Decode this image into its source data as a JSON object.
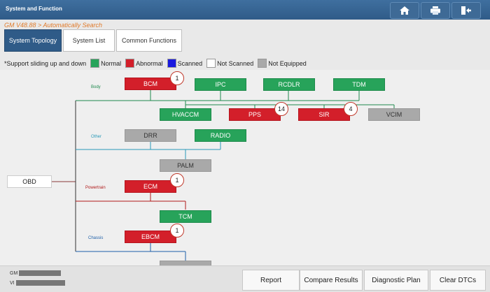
{
  "header": {
    "title": "System and Function",
    "buttons": [
      {
        "name": "home-icon"
      },
      {
        "name": "print-icon"
      },
      {
        "name": "exit-icon"
      }
    ]
  },
  "breadcrumb": "GM V48.88 > Automatically Search",
  "tabs": [
    {
      "label": "System Topology"
    },
    {
      "label": "System List"
    },
    {
      "label": "Common Functions"
    }
  ],
  "legend": {
    "note": "*Support sliding up and down",
    "items": [
      {
        "label": "Normal",
        "color": "#27a35a"
      },
      {
        "label": "Abnormal",
        "color": "#d31f2a"
      },
      {
        "label": "Scanned",
        "color": "#1a1adf"
      },
      {
        "label": "Not Scanned",
        "color": "#ffffff"
      },
      {
        "label": "Not Equipped",
        "color": "#a9a9a9"
      }
    ]
  },
  "topology": {
    "root": "OBD",
    "groups": [
      {
        "label": "Body",
        "color": "#1f8a4e"
      },
      {
        "label": "Other",
        "color": "#2a9ab8"
      },
      {
        "label": "Powertrain",
        "color": "#b01a1a"
      },
      {
        "label": "Chassis",
        "color": "#1e5fa8"
      }
    ],
    "modules": [
      {
        "label": "BCM",
        "status": "abnormal",
        "badge": "1"
      },
      {
        "label": "IPC",
        "status": "normal"
      },
      {
        "label": "RCDLR",
        "status": "normal"
      },
      {
        "label": "TDM",
        "status": "normal"
      },
      {
        "label": "HVACCM",
        "status": "normal"
      },
      {
        "label": "PPS",
        "status": "abnormal",
        "badge": "14"
      },
      {
        "label": "SIR",
        "status": "abnormal",
        "badge": "4"
      },
      {
        "label": "VCIM",
        "status": "not-equipped"
      },
      {
        "label": "DRR",
        "status": "not-equipped"
      },
      {
        "label": "RADIO",
        "status": "normal"
      },
      {
        "label": "PALM",
        "status": "not-equipped"
      },
      {
        "label": "ECM",
        "status": "abnormal",
        "badge": "1"
      },
      {
        "label": "TCM",
        "status": "normal"
      },
      {
        "label": "EBCM",
        "status": "abnormal",
        "badge": "1"
      }
    ]
  },
  "vehicle": {
    "line1_prefix": "GM",
    "line2_prefix": "VI"
  },
  "footer": {
    "buttons": [
      {
        "label": "Report"
      },
      {
        "label": "Compare Results"
      },
      {
        "label": "Diagnostic Plan"
      },
      {
        "label": "Clear DTCs"
      }
    ]
  }
}
